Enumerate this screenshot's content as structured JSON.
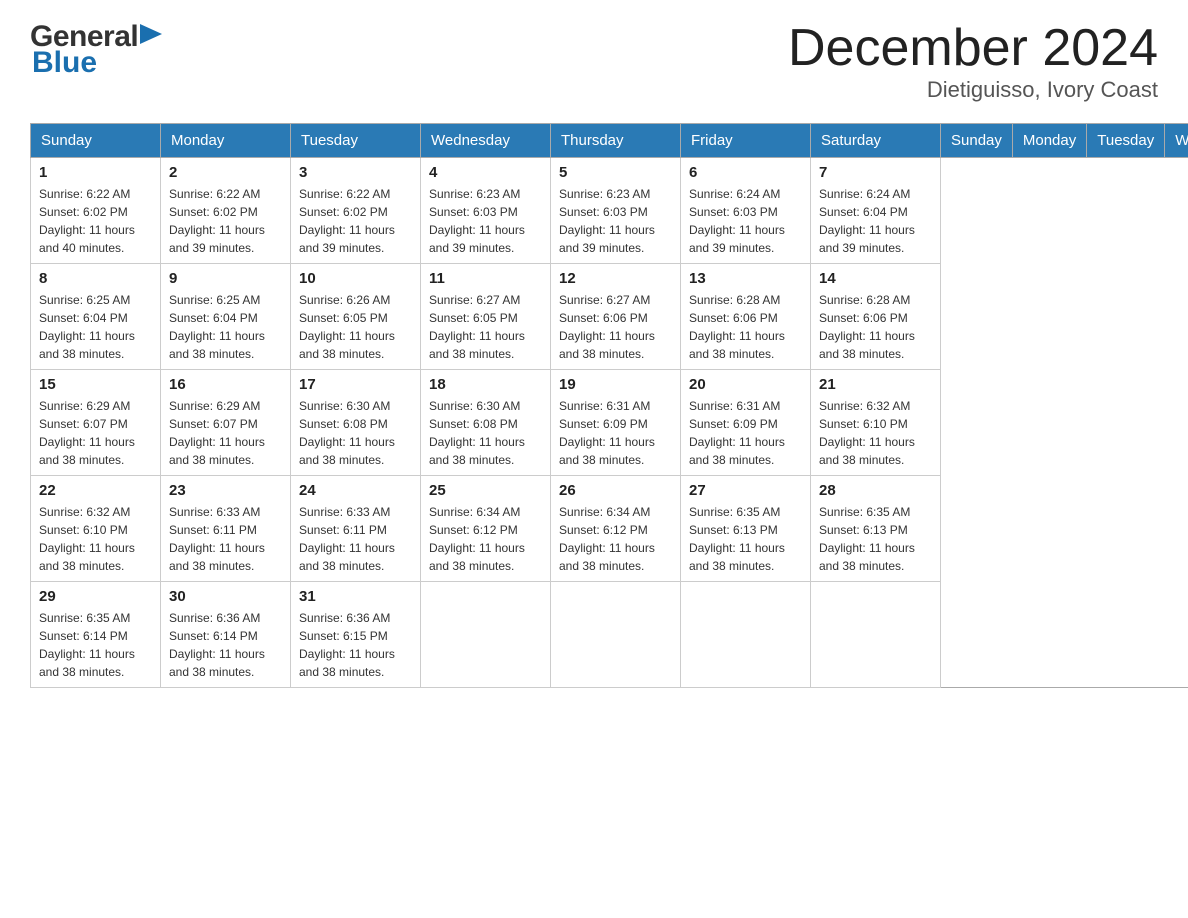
{
  "header": {
    "logo_text_general": "General",
    "logo_text_blue": "Blue",
    "title": "December 2024",
    "subtitle": "Dietiguisso, Ivory Coast"
  },
  "days_of_week": [
    "Sunday",
    "Monday",
    "Tuesday",
    "Wednesday",
    "Thursday",
    "Friday",
    "Saturday"
  ],
  "weeks": [
    [
      {
        "day": "1",
        "sunrise": "6:22 AM",
        "sunset": "6:02 PM",
        "daylight": "11 hours and 40 minutes."
      },
      {
        "day": "2",
        "sunrise": "6:22 AM",
        "sunset": "6:02 PM",
        "daylight": "11 hours and 39 minutes."
      },
      {
        "day": "3",
        "sunrise": "6:22 AM",
        "sunset": "6:02 PM",
        "daylight": "11 hours and 39 minutes."
      },
      {
        "day": "4",
        "sunrise": "6:23 AM",
        "sunset": "6:03 PM",
        "daylight": "11 hours and 39 minutes."
      },
      {
        "day": "5",
        "sunrise": "6:23 AM",
        "sunset": "6:03 PM",
        "daylight": "11 hours and 39 minutes."
      },
      {
        "day": "6",
        "sunrise": "6:24 AM",
        "sunset": "6:03 PM",
        "daylight": "11 hours and 39 minutes."
      },
      {
        "day": "7",
        "sunrise": "6:24 AM",
        "sunset": "6:04 PM",
        "daylight": "11 hours and 39 minutes."
      }
    ],
    [
      {
        "day": "8",
        "sunrise": "6:25 AM",
        "sunset": "6:04 PM",
        "daylight": "11 hours and 38 minutes."
      },
      {
        "day": "9",
        "sunrise": "6:25 AM",
        "sunset": "6:04 PM",
        "daylight": "11 hours and 38 minutes."
      },
      {
        "day": "10",
        "sunrise": "6:26 AM",
        "sunset": "6:05 PM",
        "daylight": "11 hours and 38 minutes."
      },
      {
        "day": "11",
        "sunrise": "6:27 AM",
        "sunset": "6:05 PM",
        "daylight": "11 hours and 38 minutes."
      },
      {
        "day": "12",
        "sunrise": "6:27 AM",
        "sunset": "6:06 PM",
        "daylight": "11 hours and 38 minutes."
      },
      {
        "day": "13",
        "sunrise": "6:28 AM",
        "sunset": "6:06 PM",
        "daylight": "11 hours and 38 minutes."
      },
      {
        "day": "14",
        "sunrise": "6:28 AM",
        "sunset": "6:06 PM",
        "daylight": "11 hours and 38 minutes."
      }
    ],
    [
      {
        "day": "15",
        "sunrise": "6:29 AM",
        "sunset": "6:07 PM",
        "daylight": "11 hours and 38 minutes."
      },
      {
        "day": "16",
        "sunrise": "6:29 AM",
        "sunset": "6:07 PM",
        "daylight": "11 hours and 38 minutes."
      },
      {
        "day": "17",
        "sunrise": "6:30 AM",
        "sunset": "6:08 PM",
        "daylight": "11 hours and 38 minutes."
      },
      {
        "day": "18",
        "sunrise": "6:30 AM",
        "sunset": "6:08 PM",
        "daylight": "11 hours and 38 minutes."
      },
      {
        "day": "19",
        "sunrise": "6:31 AM",
        "sunset": "6:09 PM",
        "daylight": "11 hours and 38 minutes."
      },
      {
        "day": "20",
        "sunrise": "6:31 AM",
        "sunset": "6:09 PM",
        "daylight": "11 hours and 38 minutes."
      },
      {
        "day": "21",
        "sunrise": "6:32 AM",
        "sunset": "6:10 PM",
        "daylight": "11 hours and 38 minutes."
      }
    ],
    [
      {
        "day": "22",
        "sunrise": "6:32 AM",
        "sunset": "6:10 PM",
        "daylight": "11 hours and 38 minutes."
      },
      {
        "day": "23",
        "sunrise": "6:33 AM",
        "sunset": "6:11 PM",
        "daylight": "11 hours and 38 minutes."
      },
      {
        "day": "24",
        "sunrise": "6:33 AM",
        "sunset": "6:11 PM",
        "daylight": "11 hours and 38 minutes."
      },
      {
        "day": "25",
        "sunrise": "6:34 AM",
        "sunset": "6:12 PM",
        "daylight": "11 hours and 38 minutes."
      },
      {
        "day": "26",
        "sunrise": "6:34 AM",
        "sunset": "6:12 PM",
        "daylight": "11 hours and 38 minutes."
      },
      {
        "day": "27",
        "sunrise": "6:35 AM",
        "sunset": "6:13 PM",
        "daylight": "11 hours and 38 minutes."
      },
      {
        "day": "28",
        "sunrise": "6:35 AM",
        "sunset": "6:13 PM",
        "daylight": "11 hours and 38 minutes."
      }
    ],
    [
      {
        "day": "29",
        "sunrise": "6:35 AM",
        "sunset": "6:14 PM",
        "daylight": "11 hours and 38 minutes."
      },
      {
        "day": "30",
        "sunrise": "6:36 AM",
        "sunset": "6:14 PM",
        "daylight": "11 hours and 38 minutes."
      },
      {
        "day": "31",
        "sunrise": "6:36 AM",
        "sunset": "6:15 PM",
        "daylight": "11 hours and 38 minutes."
      },
      null,
      null,
      null,
      null
    ]
  ],
  "labels": {
    "sunrise": "Sunrise:",
    "sunset": "Sunset:",
    "daylight": "Daylight:"
  }
}
